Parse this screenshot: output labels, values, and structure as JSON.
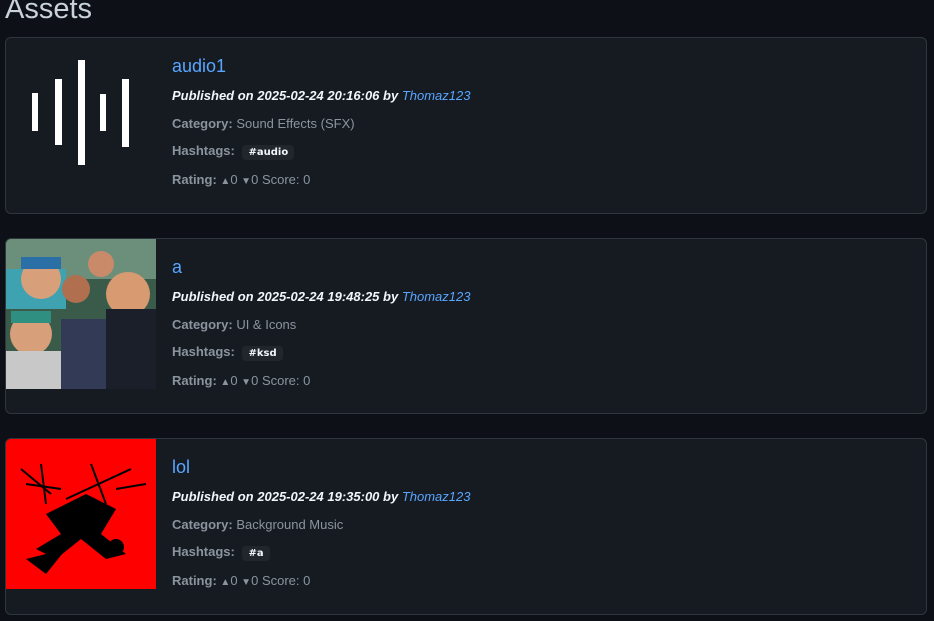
{
  "page": {
    "title": "Assets"
  },
  "labels": {
    "published_prefix": "Published on",
    "by": "by",
    "category": "Category:",
    "hashtags": "Hashtags:",
    "rating": "Rating:",
    "score": "Score:"
  },
  "icons": {
    "upvote": "upvote-icon",
    "downvote": "downvote-icon"
  },
  "colors": {
    "background": "#0d1117",
    "card": "#161b22",
    "link": "#58a6ff",
    "border": "#30363d"
  },
  "assets": [
    {
      "title": "audio1",
      "published": "2025-02-24 20:16:06",
      "author": "Thomaz123",
      "category": "Sound Effects (SFX)",
      "hashtag": "#audio",
      "upvotes": "0",
      "downvotes": "0",
      "score": "0"
    },
    {
      "title": "a",
      "published": "2025-02-24 19:48:25",
      "author": "Thomaz123",
      "category": "UI & Icons",
      "hashtag": "#ksd",
      "upvotes": "0",
      "downvotes": "0",
      "score": "0"
    },
    {
      "title": "lol",
      "published": "2025-02-24 19:35:00",
      "author": "Thomaz123",
      "category": "Background Music",
      "hashtag": "#a",
      "upvotes": "0",
      "downvotes": "0",
      "score": "0"
    }
  ]
}
